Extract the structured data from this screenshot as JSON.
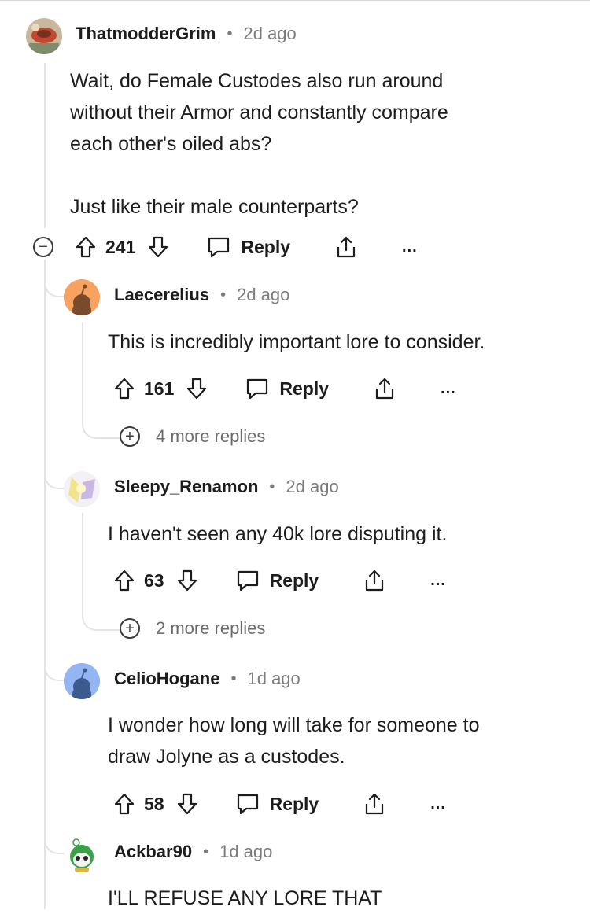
{
  "colors": {
    "text": "#1c1c1c",
    "meta": "#7c7c7c",
    "thread_line": "#e4e4e4",
    "avatar_orange": "#f8a261",
    "avatar_blue": "#93b5f3"
  },
  "comments": [
    {
      "username": "ThatmodderGrim",
      "time": "2d ago",
      "body": "Wait, do Female Custodes also run around\nwithout their Armor and constantly compare\neach other's oiled abs?\n\nJust like their male counterparts?",
      "score": "241",
      "reply_label": "Reply",
      "more_label": "..."
    },
    {
      "username": "Laecerelius",
      "time": "2d ago",
      "body": "This is incredibly important lore to consider.",
      "score": "161",
      "reply_label": "Reply",
      "more_label": "...",
      "more_replies": "4 more replies"
    },
    {
      "username": "Sleepy_Renamon",
      "time": "2d ago",
      "body": "I haven't seen any 40k lore disputing it.",
      "score": "63",
      "reply_label": "Reply",
      "more_label": "...",
      "more_replies": "2 more replies"
    },
    {
      "username": "CelioHogane",
      "time": "1d ago",
      "body": "I wonder how long will take for someone to\ndraw Jolyne as a custodes.",
      "score": "58",
      "reply_label": "Reply",
      "more_label": "..."
    },
    {
      "username": "Ackbar90",
      "time": "1d ago",
      "body": "I'LL REFUSE ANY LORE THAT"
    }
  ],
  "separator": "•",
  "collapse_symbol": "−",
  "expand_symbol": "+"
}
